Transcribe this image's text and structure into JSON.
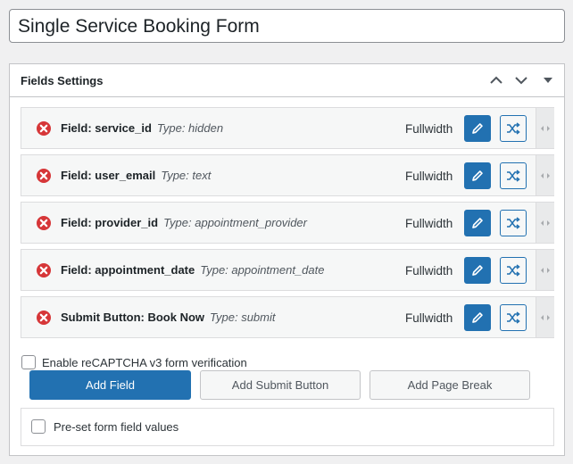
{
  "title_input": {
    "value": "Single Service Booking Form"
  },
  "postbox": {
    "title": "Fields Settings",
    "controls": [
      "chevron-up-icon",
      "chevron-down-icon",
      "triangle-down-icon"
    ]
  },
  "fields": [
    {
      "label": "Field:  service_id",
      "type": "Type: hidden",
      "width_label": "Fullwidth"
    },
    {
      "label": "Field:  user_email",
      "type": "Type: text",
      "width_label": "Fullwidth"
    },
    {
      "label": "Field:  provider_id",
      "type": "Type: appointment_provider",
      "width_label": "Fullwidth"
    },
    {
      "label": "Field:  appointment_date",
      "type": "Type: appointment_date",
      "width_label": "Fullwidth"
    },
    {
      "label": "Submit Button:  Book Now",
      "type": "Type: submit",
      "width_label": "Fullwidth"
    }
  ],
  "recaptcha": {
    "label": "Enable reCAPTCHA v3 form verification",
    "checked": false
  },
  "buttons": {
    "add_field": "Add Field",
    "add_submit": "Add Submit Button",
    "add_page_break": "Add Page Break"
  },
  "preset": {
    "label": "Pre-set form field values",
    "checked": false
  },
  "colors": {
    "accent": "#2271b1",
    "remove": "#d63638",
    "background": "#f0f0f1"
  }
}
